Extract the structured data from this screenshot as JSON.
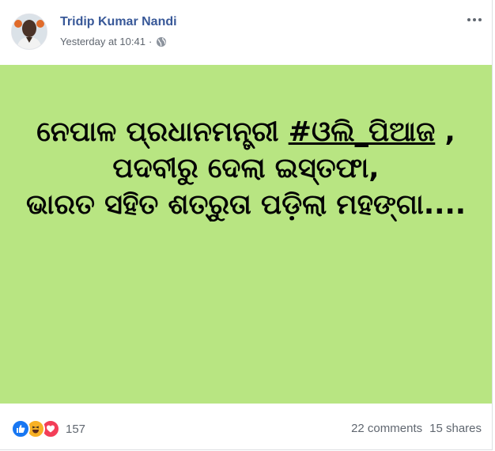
{
  "post": {
    "author": "Tridip Kumar Nandi",
    "timestamp": "Yesterday at 10:41",
    "separator": "·",
    "privacy_icon": "globe-icon",
    "menu_icon": "more-options-icon",
    "background_color": "#b8e582",
    "text": {
      "line1_prefix": "ନେପାଳ ପ୍ରଧାନମନ୍ତ୍ରୀ ",
      "hashtag": "#ଓଲି_ପିଆଜ",
      "line1_suffix": " ,",
      "line2": "ପଦବୀରୁ ଦେଲା ଇସ୍ତଫା,",
      "line3": "ଭାରତ ସହିତ ଶତ୍ରୁତା ପଡ଼ିଲା ମହଙ୍ଗା...."
    }
  },
  "footer": {
    "reaction_icons": [
      "like-icon",
      "haha-icon",
      "love-icon"
    ],
    "reaction_count": "157",
    "comments": "22 comments",
    "shares": "15 shares"
  },
  "colors": {
    "link_blue": "#385898",
    "meta_gray": "#606770",
    "like_blue": "#1877f2",
    "haha_yellow": "#f7b125",
    "love_red": "#f33e58"
  }
}
